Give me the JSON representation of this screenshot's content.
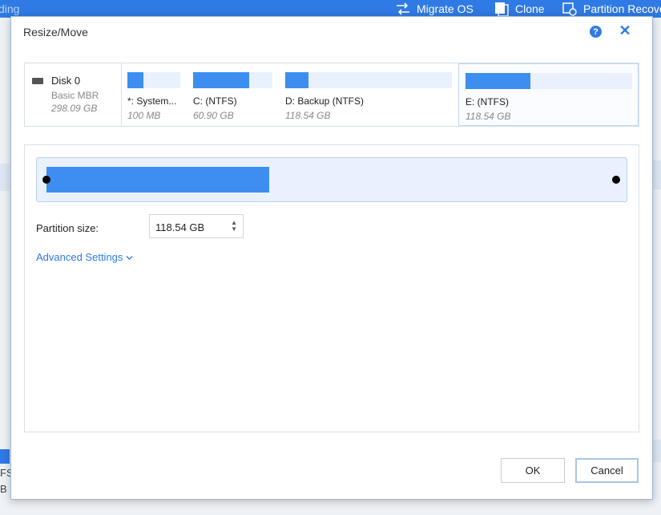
{
  "background": {
    "toolbar_fragment": "ding",
    "toolbar_items": [
      {
        "icon": "migrate-icon",
        "label": "Migrate OS"
      },
      {
        "icon": "clone-icon",
        "label": "Clone"
      },
      {
        "icon": "partition-recovery-icon",
        "label": "Partition Recove"
      }
    ],
    "left_fragment_1": "FS)",
    "left_fragment_2": "B"
  },
  "dialog": {
    "title": "Resize/Move",
    "help_label": "?",
    "close_label": "✕"
  },
  "disk": {
    "name": "Disk 0",
    "type": "Basic MBR",
    "size": "298.09 GB",
    "partitions": [
      {
        "label": "*: System...",
        "size": "100 MB",
        "used_fraction": 0.3
      },
      {
        "label": "C:  (NTFS)",
        "size": "60.90 GB",
        "used_fraction": 0.71
      },
      {
        "label": "D: Backup (NTFS)",
        "size": "118.54 GB",
        "used_fraction": 0.14
      },
      {
        "label": "E:  (NTFS)",
        "size": "118.54 GB",
        "used_fraction": 0.39,
        "selected": true
      }
    ]
  },
  "resize": {
    "used_fraction": 0.39,
    "partition_size_label": "Partition size:",
    "partition_size_value": "118.54 GB",
    "advanced_settings": "Advanced Settings"
  },
  "buttons": {
    "ok": "OK",
    "cancel": "Cancel"
  }
}
